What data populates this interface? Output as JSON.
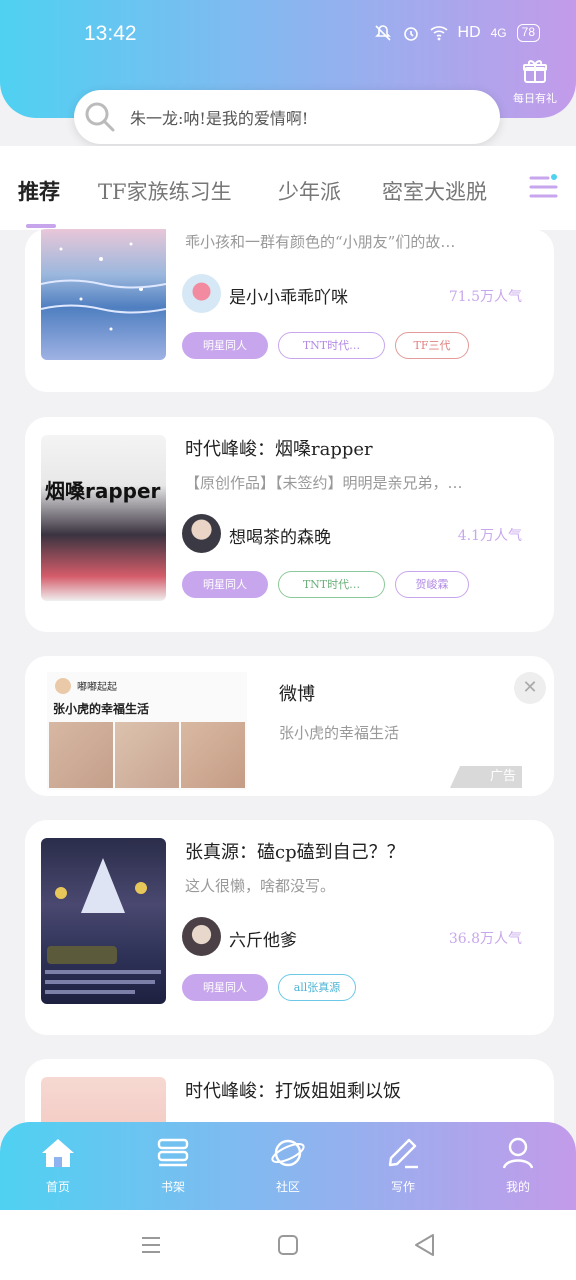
{
  "status_bar": {
    "time": "13:42",
    "network": "HD",
    "signal": "4G",
    "battery": "78"
  },
  "gift": {
    "label": "每日有礼",
    "icon": "gift-icon"
  },
  "search": {
    "text": "朱一龙:呐!是我的爱情啊!",
    "icon": "search-icon"
  },
  "tabs": [
    {
      "label": "推荐",
      "active": true
    },
    {
      "label": "TF家族练习生",
      "active": false
    },
    {
      "label": "少年派",
      "active": false
    },
    {
      "label": "密室大逃脱",
      "active": false
    }
  ],
  "cards": [
    {
      "title": "",
      "desc": "乖小孩和一群有颜色的“小朋友”们的故…",
      "author": "是小小乖乖吖咪",
      "popularity": "71.5万人气",
      "tags": [
        "明星同人",
        "TNT时代…",
        "TF三代"
      ]
    },
    {
      "title": "时代峰峻：烟嗓rapper",
      "desc": "【原创作品】【未签约】明明是亲兄弟，…",
      "author": "想喝茶的森晚",
      "popularity": "4.1万人气",
      "tags": [
        "明星同人",
        "TNT时代…",
        "贺峻霖"
      ],
      "cover_text": "烟嗓rapper"
    },
    {
      "title": "张真源：磕cp磕到自己？？",
      "desc": "这人很懒，啥都没写。",
      "author": "六斤他爹",
      "popularity": "36.8万人气",
      "tags": [
        "明星同人",
        "all张真源"
      ]
    },
    {
      "title": "时代峰峻：打饭姐姐剩以饭",
      "desc": "…"
    }
  ],
  "ad": {
    "title": "微博",
    "subtitle": "张小虎的幸福生活",
    "image_header": "嘟嘟起起",
    "image_caption": "张小虎的幸福生活",
    "badge": "广告",
    "close_icon": "close-icon"
  },
  "bottom_nav": [
    {
      "label": "首页",
      "icon": "home-icon"
    },
    {
      "label": "书架",
      "icon": "bookshelf-icon"
    },
    {
      "label": "社区",
      "icon": "planet-icon"
    },
    {
      "label": "写作",
      "icon": "pen-icon"
    },
    {
      "label": "我的",
      "icon": "user-icon"
    }
  ],
  "colors": {
    "accent": "#c8a6ee",
    "gradient_start": "#4fd1f2",
    "gradient_end": "#c39bea"
  }
}
